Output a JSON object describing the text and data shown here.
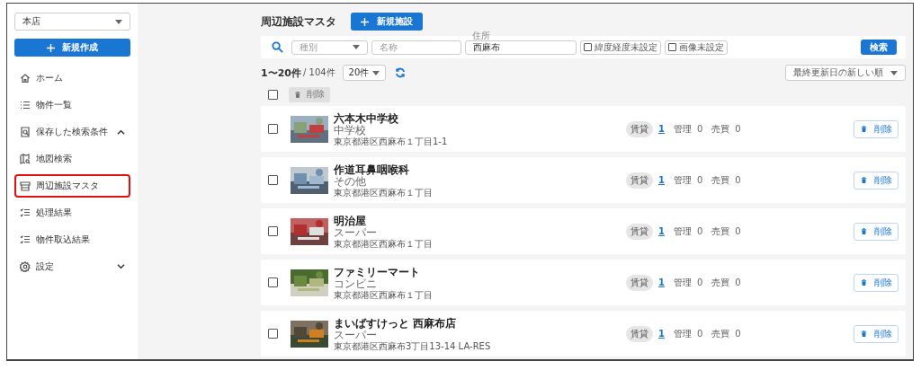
{
  "sidebar": {
    "store_select": {
      "value": "本店"
    },
    "new_button": {
      "label": "新規作成"
    },
    "items": [
      {
        "label": "ホーム",
        "kind": "link",
        "highlighted": false
      },
      {
        "label": "物件一覧",
        "kind": "link",
        "highlighted": false
      },
      {
        "label": "保存した検索条件",
        "kind": "group",
        "expanded": true,
        "highlighted": false
      },
      {
        "label": "地図検索",
        "kind": "link",
        "highlighted": false
      },
      {
        "label": "周辺施設マスタ",
        "kind": "link",
        "highlighted": true
      },
      {
        "label": "処理結果",
        "kind": "link",
        "highlighted": false
      },
      {
        "label": "物件取込結果",
        "kind": "link",
        "highlighted": false
      },
      {
        "label": "設定",
        "kind": "group",
        "expanded": false,
        "highlighted": false
      }
    ]
  },
  "header": {
    "title": "周辺施設マスタ",
    "new_button": {
      "label": "新規施設"
    }
  },
  "filters": {
    "type_select": {
      "placeholder": "種別"
    },
    "name_field": {
      "placeholder": "名称"
    },
    "address_field": {
      "label": "住所",
      "value": "西麻布"
    },
    "checkboxes": [
      {
        "label": "緯度経度未設定",
        "checked": false
      },
      {
        "label": "画像未設定",
        "checked": false
      }
    ],
    "search_button": {
      "label": "検索"
    }
  },
  "pagination": {
    "range": "1〜20件",
    "total": "/ 104件",
    "per_page": "20件",
    "sort": "最終更新日の新しい順"
  },
  "bulk": {
    "checked": false,
    "delete_button": {
      "label": "削除",
      "disabled": true
    }
  },
  "rows": [
    {
      "name": "六本木中学校",
      "category": "中学校",
      "address": "東京都港区西麻布１丁目1-1",
      "checked": false,
      "kind": "picture",
      "counts": [
        {
          "label": "賃貸",
          "value": "1",
          "kind": "link"
        },
        {
          "label": "管理",
          "value": "0",
          "kind": "plain"
        },
        {
          "label": "売買",
          "value": "0",
          "kind": "plain"
        }
      ],
      "delete": "削除"
    },
    {
      "name": "作道耳鼻咽喉科",
      "category": "その他",
      "address": "東京都港区西麻布１丁目",
      "checked": false,
      "kind": "picture",
      "counts": [
        {
          "label": "賃貸",
          "value": "1",
          "kind": "link"
        },
        {
          "label": "管理",
          "value": "0",
          "kind": "plain"
        },
        {
          "label": "売買",
          "value": "0",
          "kind": "plain"
        }
      ],
      "delete": "削除"
    },
    {
      "name": "明治屋",
      "category": "スーパー",
      "address": "東京都港区西麻布１丁目",
      "checked": false,
      "kind": "picture",
      "counts": [
        {
          "label": "賃貸",
          "value": "1",
          "kind": "link"
        },
        {
          "label": "管理",
          "value": "0",
          "kind": "plain"
        },
        {
          "label": "売買",
          "value": "0",
          "kind": "plain"
        }
      ],
      "delete": "削除"
    },
    {
      "name": "ファミリーマート",
      "category": "コンビニ",
      "address": "東京都港区西麻布１丁目",
      "checked": false,
      "kind": "picture",
      "counts": [
        {
          "label": "賃貸",
          "value": "1",
          "kind": "link"
        },
        {
          "label": "管理",
          "value": "0",
          "kind": "plain"
        },
        {
          "label": "売買",
          "value": "0",
          "kind": "plain"
        }
      ],
      "delete": "削除"
    },
    {
      "name": "まいばすけっと 西麻布店",
      "category": "スーパー",
      "address": "東京都港区西麻布3丁目13-14 LA-RES",
      "checked": false,
      "kind": "picture",
      "counts": [
        {
          "label": "賃貸",
          "value": "1",
          "kind": "link"
        },
        {
          "label": "管理",
          "value": "0",
          "kind": "plain"
        },
        {
          "label": "売買",
          "value": "0",
          "kind": "plain"
        }
      ],
      "delete": "削除"
    }
  ]
}
